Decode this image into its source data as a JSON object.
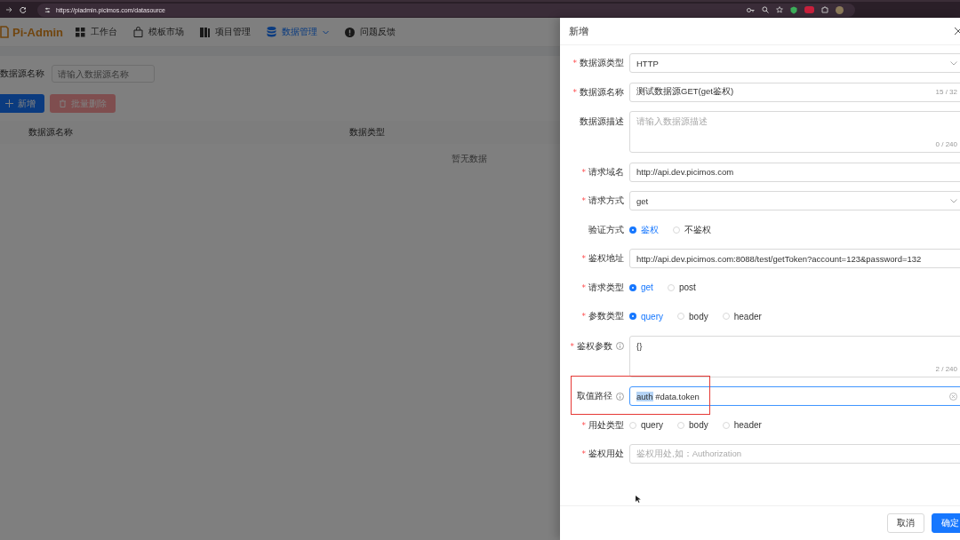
{
  "browser": {
    "url": "https://piadmin.picimos.com/datasource"
  },
  "app": {
    "logo": "Pi-Admin",
    "nav": [
      {
        "label": "工作台",
        "selected": false,
        "dropdown": false
      },
      {
        "label": "模板市场",
        "selected": false,
        "dropdown": false
      },
      {
        "label": "项目管理",
        "selected": false,
        "dropdown": false
      },
      {
        "label": "数据管理",
        "selected": true,
        "dropdown": true
      },
      {
        "label": "问题反馈",
        "selected": false,
        "dropdown": false
      }
    ],
    "search": {
      "label": "数据源名称",
      "placeholder": "请输入数据源名称"
    },
    "buttons": [
      {
        "label": "新增",
        "kind": "primary",
        "disabled": false
      },
      {
        "label": "批量删除",
        "kind": "danger",
        "disabled": true
      }
    ],
    "table": {
      "columns": [
        "数据源名称",
        "数据类型"
      ],
      "empty": "暂无数据"
    }
  },
  "drawer": {
    "title": "新增",
    "fields": [
      {
        "marker": "*",
        "label": "数据源类型",
        "kind": "select",
        "help": false,
        "value": "HTTP"
      },
      {
        "marker": "*",
        "label": "数据源名称",
        "kind": "input",
        "help": false,
        "value": "测试数据源GET(get鉴权)",
        "counter": "15 / 32"
      },
      {
        "label": "数据源描述",
        "kind": "textarea",
        "help": false,
        "placeholder": "请输入数据源描述",
        "counter": "0 / 240"
      },
      {
        "marker": "*",
        "label": "请求域名",
        "kind": "input",
        "help": false,
        "value": "http://api.dev.picimos.com"
      },
      {
        "marker": "*",
        "label": "请求方式",
        "kind": "select",
        "help": false,
        "value": "get"
      },
      {
        "label": "验证方式",
        "kind": "radio",
        "help": false,
        "options": [
          {
            "label": "鉴权",
            "selected": true
          },
          {
            "label": "不鉴权",
            "selected": false
          }
        ]
      },
      {
        "marker": "*",
        "label": "鉴权地址",
        "kind": "input",
        "help": false,
        "value": "http://api.dev.picimos.com:8088/test/getToken?account=123&password=132"
      },
      {
        "marker": "*",
        "label": "请求类型",
        "kind": "radio",
        "help": false,
        "options": [
          {
            "label": "get",
            "selected": true
          },
          {
            "label": "post",
            "selected": false
          }
        ]
      },
      {
        "marker": "*",
        "label": "参数类型",
        "kind": "radio",
        "help": false,
        "options": [
          {
            "label": "query",
            "selected": true
          },
          {
            "label": "body",
            "selected": false
          },
          {
            "label": "header",
            "selected": false
          }
        ]
      },
      {
        "marker": "*",
        "label": "鉴权参数",
        "kind": "textarea",
        "help": true,
        "value": "{}",
        "counter": "2 / 240"
      },
      {
        "label": "取值路径",
        "kind": "input",
        "help": true,
        "value": "auth #data.token",
        "focused": true,
        "clearable": true,
        "highlighted": true
      },
      {
        "marker": "*",
        "label": "用处类型",
        "kind": "radio",
        "help": false,
        "options": [
          {
            "label": "query",
            "selected": false
          },
          {
            "label": "body",
            "selected": false
          },
          {
            "label": "header",
            "selected": false
          }
        ]
      },
      {
        "marker": "*",
        "label": "鉴权用处",
        "kind": "input",
        "help": false,
        "placeholder": "鉴权用处,如：Authorization"
      }
    ],
    "actions": [
      {
        "label": "取消",
        "kind": "default"
      },
      {
        "label": "确定",
        "kind": "primary"
      }
    ]
  }
}
